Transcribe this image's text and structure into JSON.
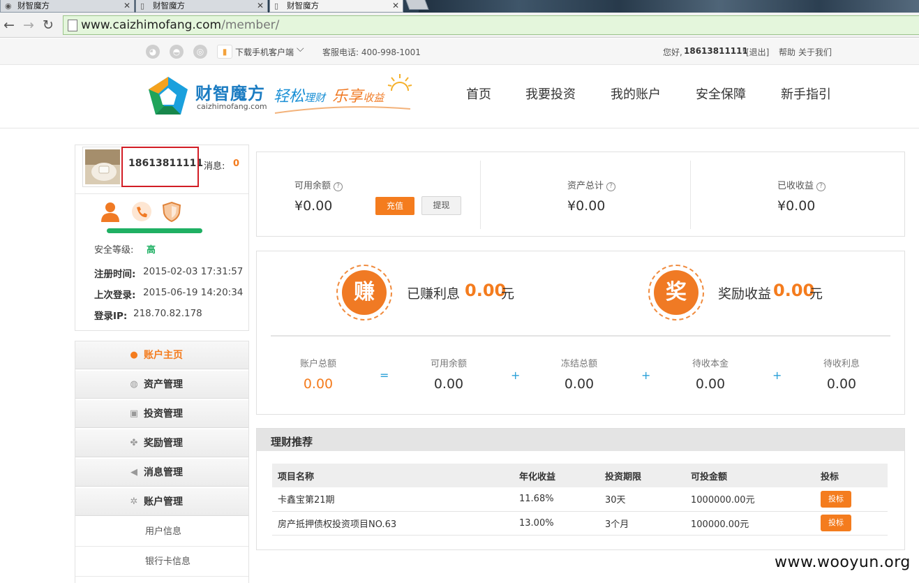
{
  "browser": {
    "tabs": [
      {
        "title": "财智魔方",
        "active": false
      },
      {
        "title": "财智魔方",
        "active": false
      },
      {
        "title": "财智魔方",
        "active": true
      }
    ],
    "url_host": "www.caizhimofang.com",
    "url_path": "/member/"
  },
  "topbar": {
    "download_label": "下载手机客户端",
    "hotline": "客服电话: 400-998-1001",
    "greeting": "您好,",
    "username": "18613811111",
    "logout": "[退出]",
    "help": "帮助",
    "about": "关于我们"
  },
  "header": {
    "logo_name": "财智魔方",
    "logo_domain": "caizhimofang.com",
    "slogan_a_big": "轻松",
    "slogan_a_small": "理财",
    "slogan_b_big": "乐享",
    "slogan_b_small": "收益",
    "nav": [
      "首页",
      "我要投资",
      "我的账户",
      "安全保障",
      "新手指引"
    ]
  },
  "profile": {
    "phone": "18613811111",
    "messages_label": "消息:",
    "messages_count": "0",
    "security_label": "安全等级:",
    "security_value": "高",
    "security_progress": 1.0,
    "register_label": "注册时间:",
    "register_value": "2015-02-03 17:31:57",
    "lastlogin_label": "上次登录:",
    "lastlogin_value": "2015-06-19 14:20:34",
    "ip_label": "登录IP:",
    "ip_value": "218.70.82.178",
    "accent": "#f47c1e",
    "green": "#1fb063"
  },
  "menu": {
    "items": [
      {
        "label": "账户主页",
        "icon": "user-icon",
        "active": true
      },
      {
        "label": "资产管理",
        "icon": "coins-icon"
      },
      {
        "label": "投资管理",
        "icon": "disk-icon"
      },
      {
        "label": "奖励管理",
        "icon": "gift-icon"
      },
      {
        "label": "消息管理",
        "icon": "speaker-icon"
      },
      {
        "label": "账户管理",
        "icon": "gear-icon"
      }
    ],
    "subitems": [
      "用户信息",
      "银行卡信息"
    ]
  },
  "balance": {
    "available_label": "可用余额",
    "available_value": "¥0.00",
    "recharge": "充值",
    "withdraw": "提现",
    "assets_label": "资产总计",
    "assets_value": "¥0.00",
    "received_label": "已收收益",
    "received_value": "¥0.00"
  },
  "earnings": {
    "earn_badge": "赚",
    "earn_label": "已赚利息",
    "earn_value": "0.00",
    "earn_unit": "元",
    "reward_badge": "奖",
    "reward_label": "奖励收益",
    "reward_value": "0.00",
    "reward_unit": "元",
    "summary": [
      {
        "label": "账户总额",
        "value": "0.00"
      },
      {
        "label": "可用余额",
        "value": "0.00"
      },
      {
        "label": "冻结总额",
        "value": "0.00"
      },
      {
        "label": "待收本金",
        "value": "0.00"
      },
      {
        "label": "待收利息",
        "value": "0.00"
      }
    ],
    "ops": [
      "=",
      "+",
      "+",
      "+"
    ]
  },
  "recommend": {
    "title": "理财推荐",
    "columns": [
      "项目名称",
      "年化收益",
      "投资期限",
      "可投金额",
      "投标"
    ],
    "rows": [
      {
        "name": "卡鑫宝第21期",
        "rate": "11.68%",
        "term": "30天",
        "amount": "1000000.00元",
        "action": "投标"
      },
      {
        "name": "房产抵押债权投资项目NO.63",
        "rate": "13.00%",
        "term": "3个月",
        "amount": "100000.00元",
        "action": "投标"
      }
    ]
  },
  "watermark": "www.wooyun.org"
}
